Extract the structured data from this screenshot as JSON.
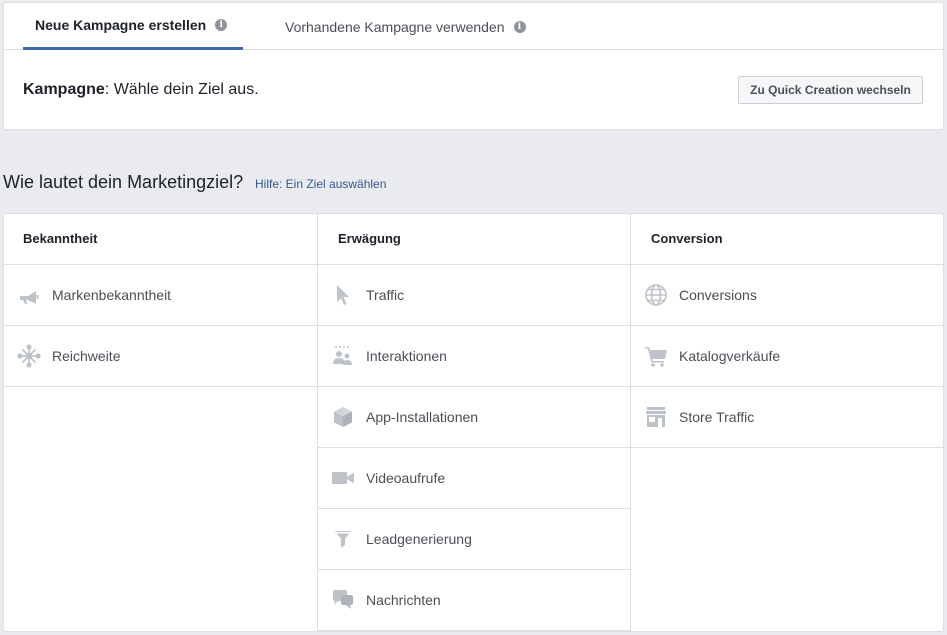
{
  "tabs": [
    {
      "label": "Neue Kampagne erstellen",
      "active": true
    },
    {
      "label": "Vorhandene Kampagne verwenden",
      "active": false
    }
  ],
  "campaign": {
    "label": "Kampagne",
    "text": ": Wähle dein Ziel aus."
  },
  "quick_button": "Zu Quick Creation wechseln",
  "question": "Wie lautet dein Marketingziel?",
  "help_link": "Hilfe: Ein Ziel auswählen",
  "columns": [
    {
      "title": "Bekanntheit",
      "items": [
        {
          "label": "Markenbekanntheit",
          "icon": "megaphone-icon"
        },
        {
          "label": "Reichweite",
          "icon": "reach-icon"
        }
      ]
    },
    {
      "title": "Erwägung",
      "items": [
        {
          "label": "Traffic",
          "icon": "cursor-icon"
        },
        {
          "label": "Interaktionen",
          "icon": "people-icon"
        },
        {
          "label": "App-Installationen",
          "icon": "box-icon"
        },
        {
          "label": "Videoaufrufe",
          "icon": "video-camera-icon"
        },
        {
          "label": "Leadgenerierung",
          "icon": "funnel-icon"
        },
        {
          "label": "Nachrichten",
          "icon": "chat-bubbles-icon"
        }
      ]
    },
    {
      "title": "Conversion",
      "items": [
        {
          "label": "Conversions",
          "icon": "globe-icon"
        },
        {
          "label": "Katalogverkäufe",
          "icon": "shopping-cart-icon"
        },
        {
          "label": "Store Traffic",
          "icon": "store-icon"
        }
      ]
    }
  ],
  "colors": {
    "accent": "#4267b2",
    "icon": "#bec3c9",
    "link": "#365899"
  }
}
